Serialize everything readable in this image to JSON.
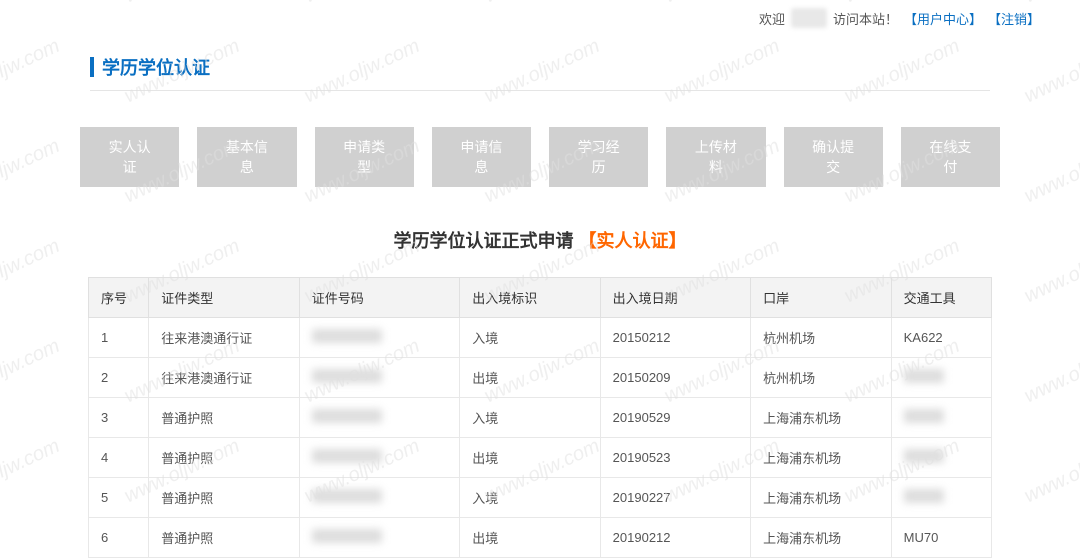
{
  "watermark": "www.oljw.com",
  "topbar": {
    "welcome": "欢迎",
    "visit": "访问本站！",
    "user_center": "【用户中心】",
    "logout": "【注销】"
  },
  "section_title": "学历学位认证",
  "steps": [
    "实人认证",
    "基本信息",
    "申请类型",
    "申请信息",
    "学习经历",
    "上传材料",
    "确认提交",
    "在线支付"
  ],
  "main_title": {
    "black": "学历学位认证正式申请",
    "orange": "【实人认证】"
  },
  "table": {
    "headers": [
      "序号",
      "证件类型",
      "证件号码",
      "出入境标识",
      "出入境日期",
      "口岸",
      "交通工具"
    ],
    "rows": [
      {
        "no": "1",
        "type": "往来港澳通行证",
        "idno": "",
        "flag": "入境",
        "date": "20150212",
        "port": "杭州机场",
        "vehicle": "KA622"
      },
      {
        "no": "2",
        "type": "往来港澳通行证",
        "idno": "",
        "flag": "出境",
        "date": "20150209",
        "port": "杭州机场",
        "vehicle": ""
      },
      {
        "no": "3",
        "type": "普通护照",
        "idno": "",
        "flag": "入境",
        "date": "20190529",
        "port": "上海浦东机场",
        "vehicle": ""
      },
      {
        "no": "4",
        "type": "普通护照",
        "idno": "",
        "flag": "出境",
        "date": "20190523",
        "port": "上海浦东机场",
        "vehicle": ""
      },
      {
        "no": "5",
        "type": "普通护照",
        "idno": "",
        "flag": "入境",
        "date": "20190227",
        "port": "上海浦东机场",
        "vehicle": ""
      },
      {
        "no": "6",
        "type": "普通护照",
        "idno": "",
        "flag": "出境",
        "date": "20190212",
        "port": "上海浦东机场",
        "vehicle": "MU70"
      }
    ]
  }
}
